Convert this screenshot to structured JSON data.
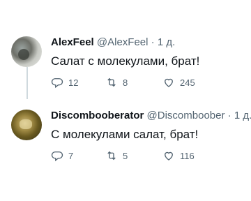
{
  "tweets": [
    {
      "display_name": "AlexFeel",
      "handle": "@AlexFeel",
      "separator": "·",
      "time": "1 д.",
      "text": "Салат с молекулами, брат!",
      "replies": "12",
      "retweets": "8",
      "likes": "245"
    },
    {
      "display_name": "Discombooberator",
      "handle": "@Discomboober",
      "separator": "·",
      "time": "1 д.",
      "text": "С молекулами салат, брат!",
      "replies": "7",
      "retweets": "5",
      "likes": "116"
    }
  ],
  "icons": {
    "reply": "reply-icon",
    "retweet": "retweet-icon",
    "like": "heart-icon"
  },
  "colors": {
    "text": "#0f1419",
    "secondary": "#536471",
    "thread_line": "#cfd9de"
  }
}
